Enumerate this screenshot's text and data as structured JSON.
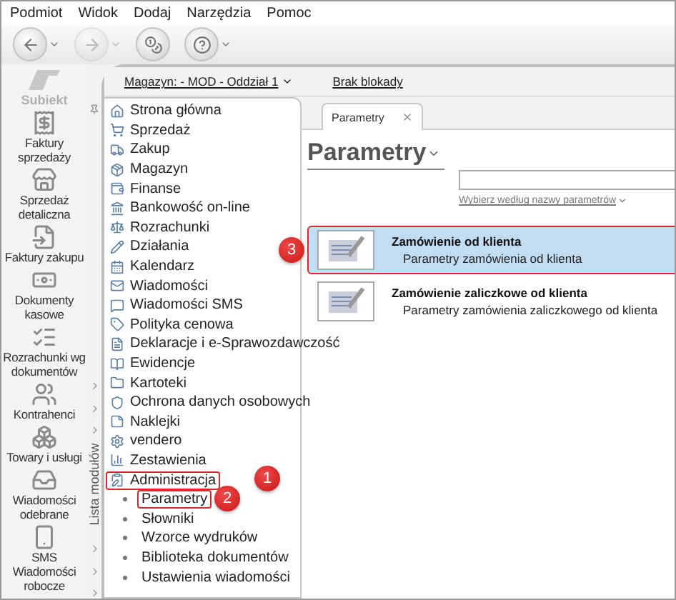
{
  "menu": [
    "Podmiot",
    "Widok",
    "Dodaj",
    "Narzędzia",
    "Pomoc"
  ],
  "toolbar": [
    {
      "disabled": false,
      "dropdown": true
    },
    {
      "disabled": true,
      "dropdown": true
    },
    {
      "disabled": false,
      "dropdown": false
    },
    {
      "disabled": false,
      "dropdown": true
    }
  ],
  "sidebar": {
    "logo": "Subiekt",
    "items": [
      "Faktury sprzedaży",
      "Sprzedaż detaliczna",
      "Faktury zakupu",
      "Dokumenty kasowe",
      "Rozrachunki wg dokumentów",
      "Kontrahenci",
      "Towary i usługi",
      "Wiadomości odebrane",
      "SMS Wiadomości robocze"
    ]
  },
  "header": {
    "warehouse": "Magazyn: - MOD - Oddział 1",
    "lock": "Brak blokady"
  },
  "module_list": {
    "title": "Lista modułów",
    "items": [
      {
        "label": "Strona główna"
      },
      {
        "label": "Sprzedaż"
      },
      {
        "label": "Zakup"
      },
      {
        "label": "Magazyn"
      },
      {
        "label": "Finanse"
      },
      {
        "label": "Bankowość on-line"
      },
      {
        "label": "Rozrachunki"
      },
      {
        "label": "Działania"
      },
      {
        "label": "Kalendarz"
      },
      {
        "label": "Wiadomości"
      },
      {
        "label": "Wiadomości SMS"
      },
      {
        "label": "Polityka cenowa"
      },
      {
        "label": "Deklaracje i e-Sprawozdawczość"
      },
      {
        "label": "Ewidencje"
      },
      {
        "label": "Kartoteki"
      },
      {
        "label": "Ochrona danych osobowych"
      },
      {
        "label": "Naklejki"
      },
      {
        "label": "vendero"
      },
      {
        "label": "Zestawienia"
      },
      {
        "label": "Administracja",
        "highlighted": true,
        "badge": "1",
        "expanded": true,
        "children": [
          {
            "label": "Parametry",
            "highlighted": true,
            "badge": "2"
          },
          {
            "label": "Słowniki",
            "highlighted": false
          },
          {
            "label": "Wzorce wydruków",
            "highlighted": false
          },
          {
            "label": "Biblioteka dokumentów",
            "highlighted": false
          },
          {
            "label": "Ustawienia wiadomości",
            "highlighted": false
          }
        ]
      }
    ]
  },
  "tabs": [
    {
      "label": "Parametry",
      "selected": true
    }
  ],
  "page": {
    "title": "Parametry",
    "filter_link": "Wybierz według nazwy parametrów"
  },
  "rows": [
    {
      "title": "Zamówienie od klienta",
      "subtitle": "Parametry zamówienia od klienta",
      "selected": true,
      "highlighted": true,
      "badge": "3"
    },
    {
      "title": "Zamówienie zaliczkowe od klienta",
      "subtitle": "Parametry zamówienia zaliczkowego od klienta",
      "selected": false,
      "highlighted": false
    }
  ]
}
